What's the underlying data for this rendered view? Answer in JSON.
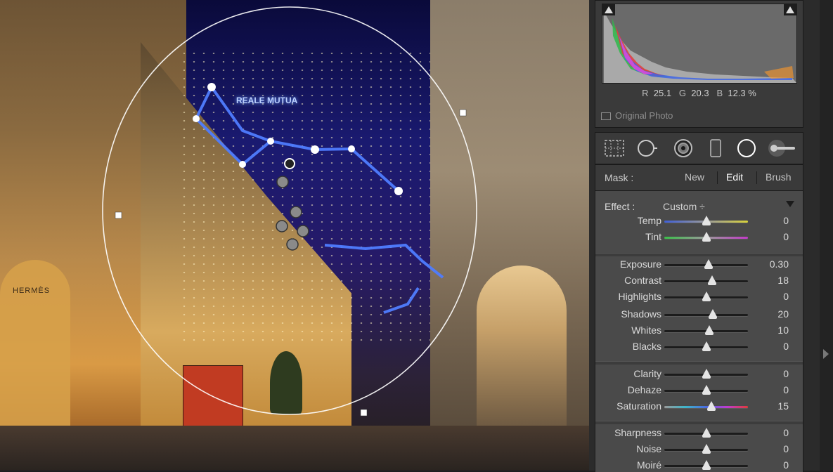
{
  "photo": {
    "neon_sign": "REALE MUTUA",
    "shop_sign": "HERMÈS"
  },
  "histogram": {
    "r_label": "R",
    "r_value": "25.1",
    "g_label": "G",
    "g_value": "20.3",
    "b_label": "B",
    "b_value": "12.3",
    "unit": "%",
    "original_photo_label": "Original Photo"
  },
  "tools": [
    "crop-grid-icon",
    "spot-removal-icon",
    "red-eye-icon",
    "graduated-filter-icon",
    "radial-filter-icon",
    "adjustment-brush-icon"
  ],
  "mask": {
    "label": "Mask :",
    "new": "New",
    "edit": "Edit",
    "brush": "Brush"
  },
  "effect": {
    "label": "Effect :",
    "value": "Custom ÷"
  },
  "sliders": [
    {
      "label": "Temp",
      "value": "0",
      "pos": 0.5,
      "track": "temp"
    },
    {
      "label": "Tint",
      "value": "0",
      "pos": 0.5,
      "track": "tint"
    },
    {
      "label": "Exposure",
      "value": "0.30",
      "pos": 0.53,
      "track": "gray"
    },
    {
      "label": "Contrast",
      "value": "18",
      "pos": 0.57,
      "track": "gray"
    },
    {
      "label": "Highlights",
      "value": "0",
      "pos": 0.5,
      "track": "gray"
    },
    {
      "label": "Shadows",
      "value": "20",
      "pos": 0.58,
      "track": "gray"
    },
    {
      "label": "Whites",
      "value": "10",
      "pos": 0.54,
      "track": "gray"
    },
    {
      "label": "Blacks",
      "value": "0",
      "pos": 0.5,
      "track": "gray"
    },
    {
      "label": "Clarity",
      "value": "0",
      "pos": 0.5,
      "track": "gray"
    },
    {
      "label": "Dehaze",
      "value": "0",
      "pos": 0.5,
      "track": "gray"
    },
    {
      "label": "Saturation",
      "value": "15",
      "pos": 0.56,
      "track": "sat"
    },
    {
      "label": "Sharpness",
      "value": "0",
      "pos": 0.5,
      "track": "gray"
    },
    {
      "label": "Noise",
      "value": "0",
      "pos": 0.5,
      "track": "gray"
    },
    {
      "label": "Moiré",
      "value": "0",
      "pos": 0.5,
      "track": "gray"
    }
  ],
  "colors": {
    "panel_bg": "#2b2b2b",
    "section_bg": "#4a4a4a",
    "text": "#dadada",
    "active_text": "#ffffff"
  }
}
